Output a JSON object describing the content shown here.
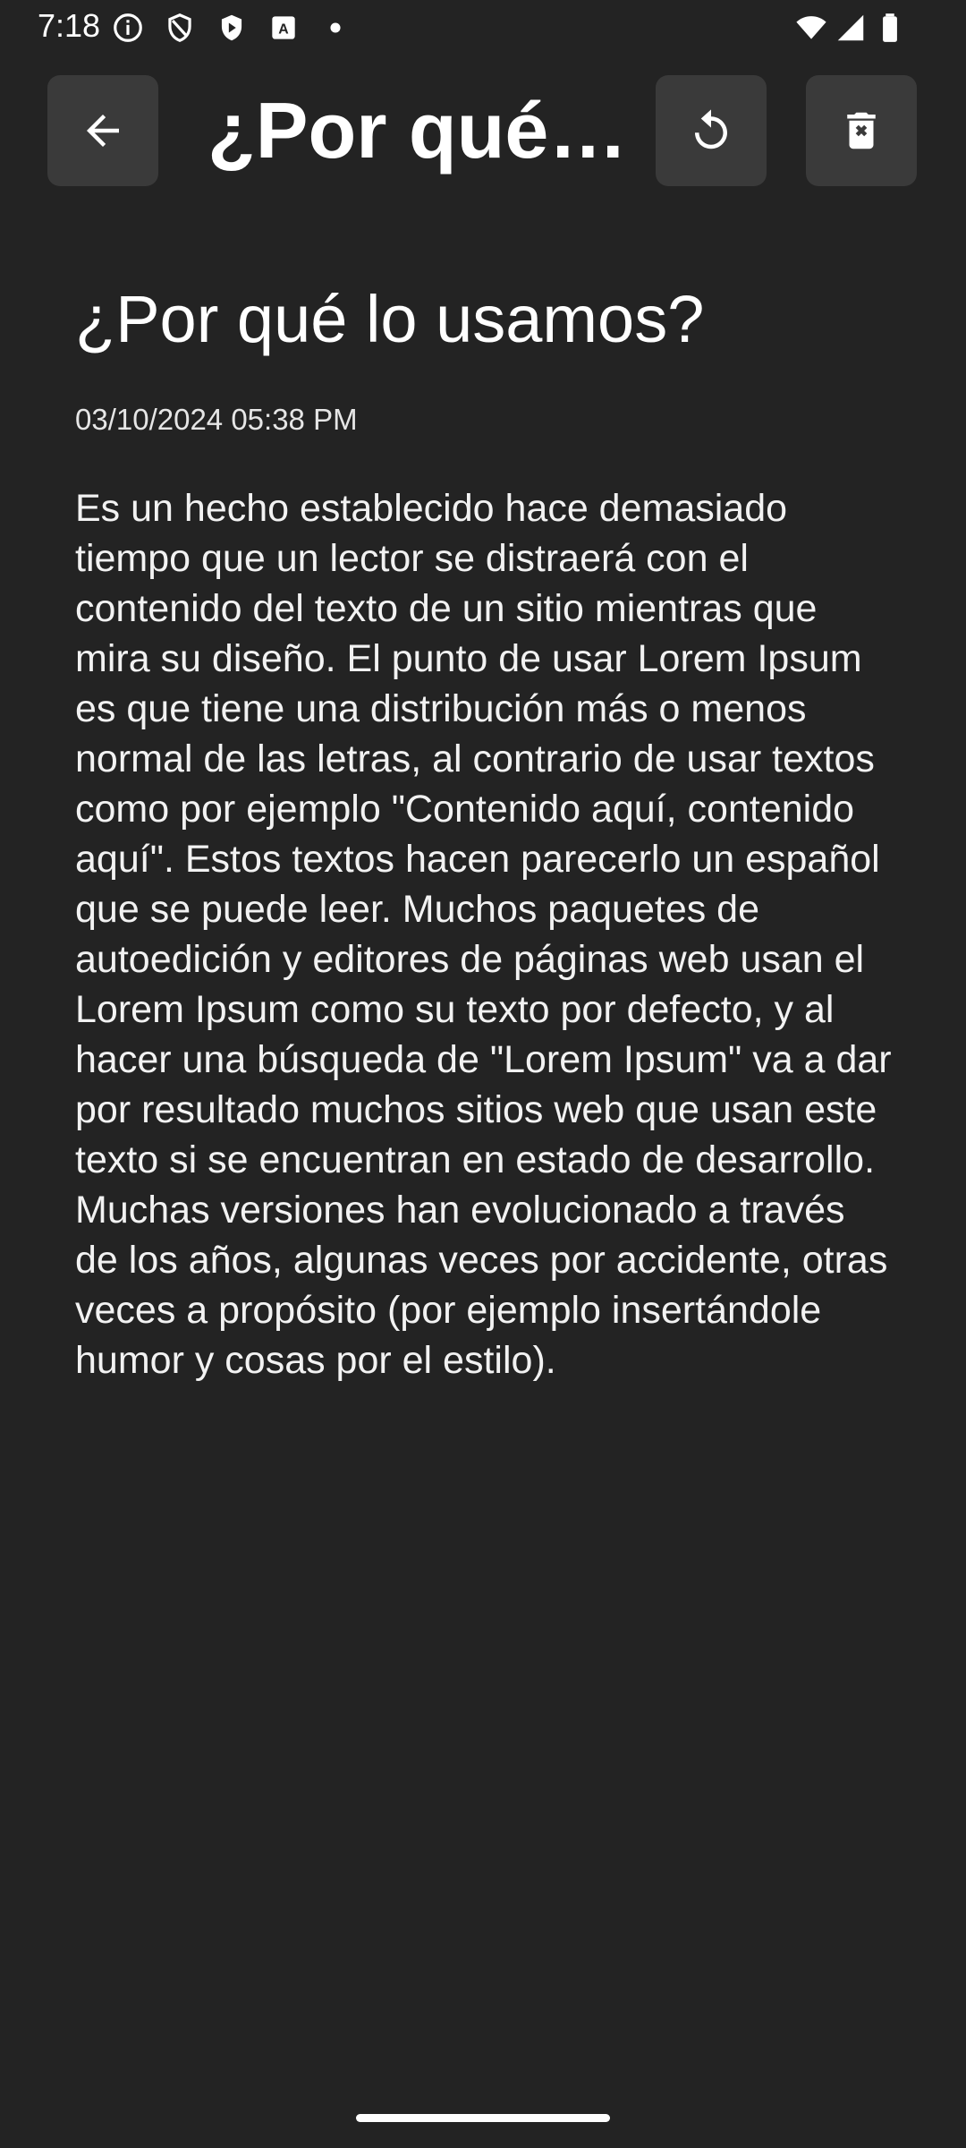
{
  "status_bar": {
    "time": "7:18",
    "left_icons": [
      "info-icon",
      "shield-icon",
      "play-protect-icon",
      "translate-icon",
      "dot-icon"
    ],
    "right_icons": [
      "wifi-icon",
      "signal-icon",
      "battery-icon"
    ]
  },
  "app_bar": {
    "title": "¿Por qué lo usamos?",
    "back_icon": "arrow-back-icon",
    "restore_icon": "restore-icon",
    "delete_icon": "delete-forever-icon"
  },
  "note": {
    "title": "¿Por qué lo usamos?",
    "date": "03/10/2024 05:38 PM",
    "body": "Es un hecho establecido hace demasiado tiempo que un lector se distraerá con el contenido del texto de un sitio mientras que mira su diseño. El punto de usar Lorem Ipsum es que tiene una distribución más o menos normal de las letras, al contrario de usar textos como por ejemplo \"Contenido aquí, contenido aquí\". Estos textos hacen parecerlo un español que se puede leer. Muchos paquetes de autoedición y editores de páginas web usan el Lorem Ipsum como su texto por defecto, y al hacer una búsqueda de \"Lorem Ipsum\" va a dar por resultado muchos sitios web que usan este texto si se encuentran en estado de desarrollo. Muchas versiones han evolucionado a través de los años, algunas veces por accidente, otras veces a propósito (por ejemplo insertándole humor y cosas por el estilo)."
  },
  "colors": {
    "background": "#232323",
    "button_background": "#3a3a3a",
    "text": "#ffffff"
  }
}
